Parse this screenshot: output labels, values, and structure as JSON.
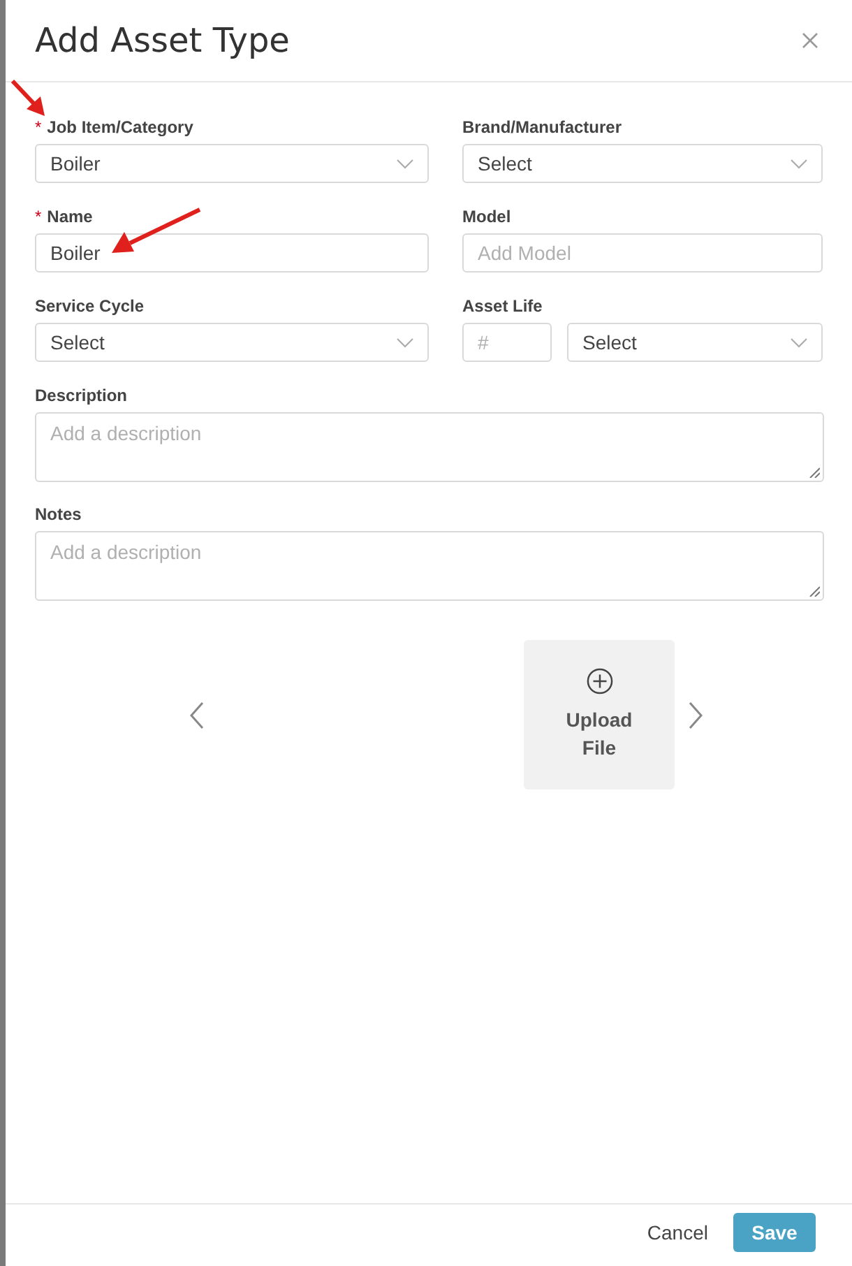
{
  "dialog": {
    "title": "Add Asset Type",
    "required_mark": "*"
  },
  "rows": [
    {
      "kind": "pair",
      "fields": [
        {
          "label": "Job Item/Category",
          "required": true,
          "kind": "select",
          "value": "Boiler"
        },
        {
          "label": "Brand/Manufacturer",
          "required": false,
          "kind": "select",
          "value": "Select"
        }
      ]
    },
    {
      "kind": "pair",
      "fields": [
        {
          "label": "Name",
          "required": true,
          "kind": "input",
          "value": "Boiler"
        },
        {
          "label": "Model",
          "required": false,
          "kind": "input",
          "placeholder": "Add Model"
        }
      ]
    },
    {
      "kind": "pair",
      "fields": [
        {
          "label": "Service Cycle",
          "required": false,
          "kind": "select",
          "value": "Select"
        },
        {
          "label": "Asset Life",
          "required": false,
          "kind": "numberselect",
          "placeholder": "#",
          "value": "Select"
        }
      ]
    },
    {
      "kind": "wide",
      "fields": [
        {
          "label": "Description",
          "required": false,
          "kind": "textarea",
          "placeholder": "Add a description"
        }
      ]
    },
    {
      "kind": "wide",
      "fields": [
        {
          "label": "Notes",
          "required": false,
          "kind": "textarea",
          "placeholder": "Add a description"
        }
      ]
    }
  ],
  "upload": {
    "label_line1": "Upload",
    "label_line2": "File"
  },
  "footer": {
    "cancel": "Cancel",
    "save": "Save"
  }
}
